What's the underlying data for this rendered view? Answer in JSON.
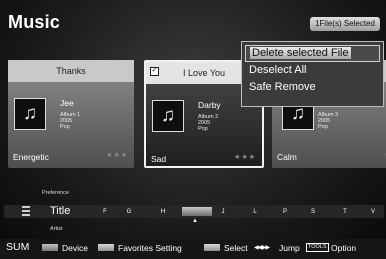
{
  "header": {
    "title": "Music",
    "badge": "1File(s) Selected"
  },
  "cards": [
    {
      "title": "Thanks",
      "artist": "Jee",
      "album": "Album 1",
      "year": "2005",
      "genre": "Pop",
      "mood": "Energetic",
      "selected": false
    },
    {
      "title": "I Love You",
      "artist": "Darby",
      "album": "Album 2",
      "year": "2005",
      "genre": "Pop",
      "mood": "Sad",
      "selected": true
    },
    {
      "title": "",
      "artist": "",
      "album": "Album 3",
      "year": "2005",
      "genre": "Pop",
      "mood": "Calm",
      "selected": false
    }
  ],
  "context_menu": {
    "items": [
      "Delete selected File",
      "Deselect All",
      "Safe Remove"
    ],
    "highlighted_index": 0
  },
  "sort": {
    "prev": "Preference",
    "current": "Title",
    "next": "Artist"
  },
  "alpha_index": [
    "F",
    "G",
    "H",
    "",
    "J",
    "L",
    "P",
    "S",
    "T",
    "V"
  ],
  "footer": {
    "mode": "SUM",
    "device": "Device",
    "favorites": "Favorites Setting",
    "select": "Select",
    "jump_icon": "◀◀ ▶▶",
    "jump": "Jump",
    "tools_key": "TOOLS",
    "option": "Option"
  },
  "icons": {
    "track": "music-note-icon",
    "stars": "rating-stars-icon"
  }
}
